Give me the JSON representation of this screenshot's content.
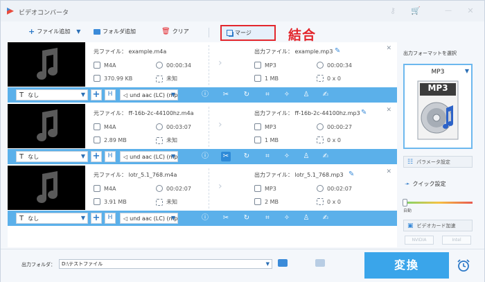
{
  "app": {
    "title": "ビデオコンバータ"
  },
  "toolbar": {
    "add_file": "ファイル追加",
    "add_folder": "フォルダ追加",
    "clear": "クリア",
    "merge": "マージ"
  },
  "annotation": {
    "merge_label": "結合"
  },
  "files": [
    {
      "src_name": "元ファイル： example.m4a",
      "src_format": "M4A",
      "src_duration": "00:00:34",
      "src_size": "370.99 KB",
      "src_res": "未知",
      "dst_name": "出力ファイル： example.mp3",
      "dst_format": "MP3",
      "dst_duration": "00:00:34",
      "dst_size": "1 MB",
      "dst_res": "0 x 0",
      "subtitle": "なし",
      "audio": "und aac (LC) (mp"
    },
    {
      "src_name": "元ファイル： ff-16b-2c-44100hz.m4a",
      "src_format": "M4A",
      "src_duration": "00:03:07",
      "src_size": "2.89 MB",
      "src_res": "未知",
      "dst_name": "出力ファイル： ff-16b-2c-44100hz.mp3",
      "dst_format": "MP3",
      "dst_duration": "00:00:27",
      "dst_size": "1 MB",
      "dst_res": "0 x 0",
      "subtitle": "なし",
      "audio": "und aac (LC) (mp"
    },
    {
      "src_name": "元ファイル： lotr_5.1_768.m4a",
      "src_format": "M4A",
      "src_duration": "00:02:07",
      "src_size": "3.91 MB",
      "src_res": "未知",
      "dst_name": "出力ファイル： lotr_5.1_768.mp3",
      "dst_format": "MP3",
      "dst_duration": "00:02:07",
      "dst_size": "2 MB",
      "dst_res": "0 x 0",
      "subtitle": "なし",
      "audio": "und aac (LC) (mp"
    }
  ],
  "sidebar": {
    "title": "出力フォーマットを選択",
    "format": "MP3",
    "format_badge": "MP3",
    "params": "パラメータ設定",
    "quick": "クイック設定",
    "auto": "自動",
    "gpu": "ビデオカード加速",
    "nvidia": "NVIDIA",
    "intel": "Intel"
  },
  "bottom": {
    "output_label": "出力フォルダ：",
    "output_path": "D:\\テストファイル",
    "convert": "変換"
  },
  "colors": {
    "accent": "#3aa5ea",
    "bar": "#5bb0ea",
    "highlight": "#e3262c"
  }
}
